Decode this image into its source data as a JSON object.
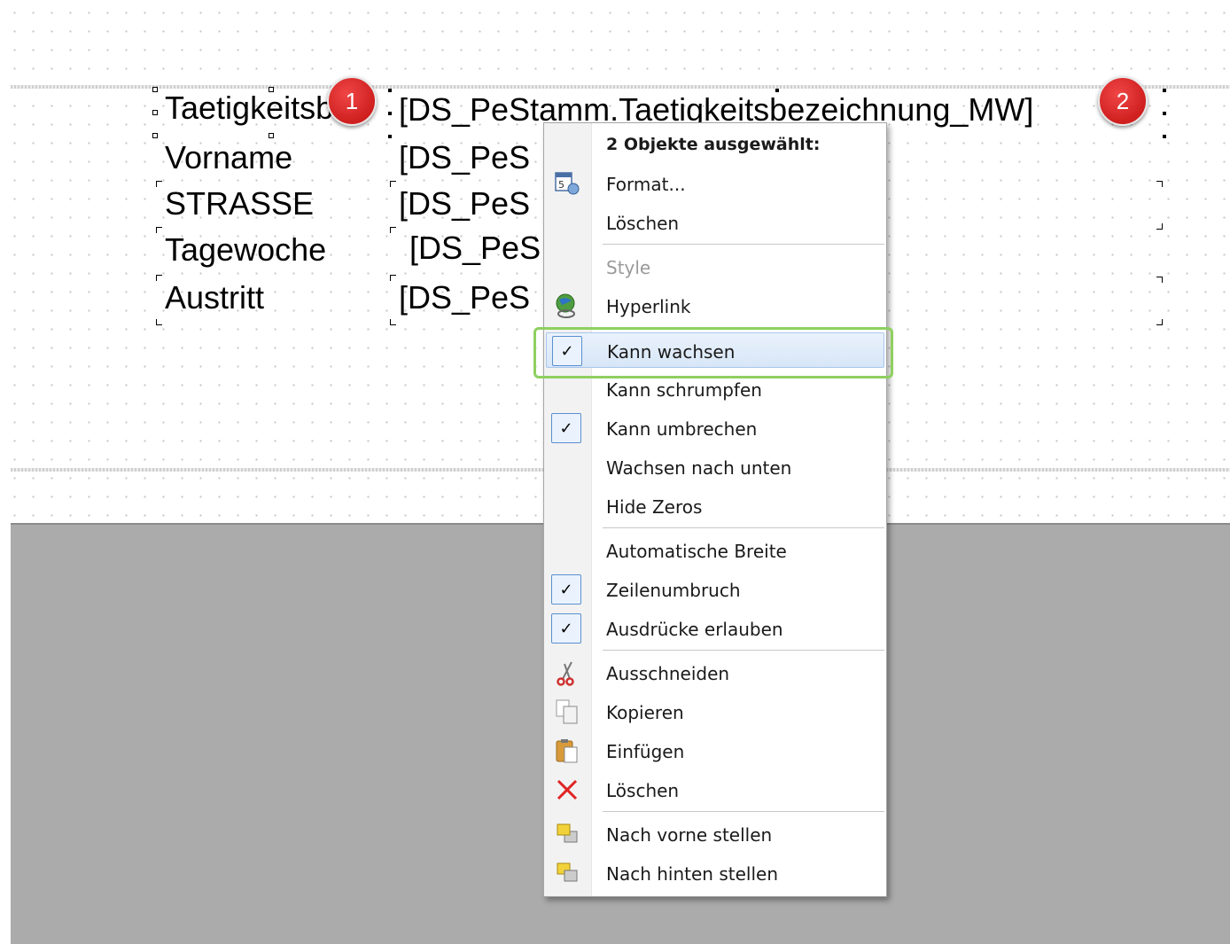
{
  "report_fields": {
    "labels": [
      "Taetigkeitsbe",
      "Vorname",
      "STRASSE",
      "Tagewoche",
      "Austritt"
    ],
    "values": [
      "[DS_PeStamm.Taetigkeitsbezeichnung_MW]",
      "[DS_PeS",
      "[DS_PeS",
      "[DS_PeS",
      "[DS_PeS"
    ]
  },
  "badges": [
    "1",
    "2"
  ],
  "context_menu": {
    "header": "2 Objekte ausgewählt:",
    "items": {
      "format": "Format...",
      "delete_top": "Löschen",
      "style": "Style",
      "hyperlink": "Hyperlink",
      "can_grow": "Kann wachsen",
      "can_shrink": "Kann schrumpfen",
      "can_break": "Kann umbrechen",
      "grow_down": "Wachsen nach unten",
      "hide_zeros": "Hide Zeros",
      "auto_width": "Automatische Breite",
      "word_wrap": "Zeilenumbruch",
      "allow_expressions": "Ausdrücke erlauben",
      "cut": "Ausschneiden",
      "copy": "Kopieren",
      "paste": "Einfügen",
      "delete": "Löschen",
      "bring_front": "Nach vorne stellen",
      "send_back": "Nach hinten stellen"
    },
    "checked": {
      "can_grow": true,
      "can_break": true,
      "word_wrap": true,
      "allow_expressions": true
    },
    "highlighted": "can_grow"
  },
  "colors": {
    "badge": "#d92b2b",
    "focus_ring": "#8ed060",
    "highlight": "#d7e6f8",
    "workspace": "#ababab"
  }
}
